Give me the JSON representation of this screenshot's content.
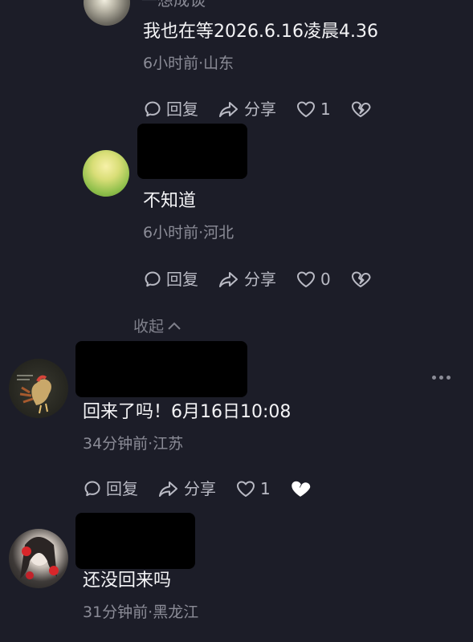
{
  "comments": [
    {
      "name_partial": "一想成谈",
      "text": "我也在等2026.6.16凌晨4.36",
      "meta": "6小时前·山东",
      "reply_label": "回复",
      "share_label": "分享",
      "like_count": "1"
    },
    {
      "text": "不知道",
      "meta": "6小时前·河北",
      "reply_label": "回复",
      "share_label": "分享",
      "like_count": "0"
    },
    {
      "text": "回来了吗！6月16日10:08",
      "meta": "34分钟前·江苏",
      "reply_label": "回复",
      "share_label": "分享",
      "like_count": "1"
    },
    {
      "text": "还没回来吗",
      "meta": "31分钟前·黑龙江"
    }
  ],
  "collapse_label": "收起",
  "icons": {
    "reply": "reply-bubble-icon",
    "share": "share-arrow-icon",
    "like": "heart-icon",
    "dislike": "broken-heart-icon",
    "collapse": "chevron-up-icon",
    "more": "more-dots-icon"
  },
  "colors": {
    "background": "#1c1d28",
    "text": "#f4f4f6",
    "meta": "#8b8c97"
  }
}
